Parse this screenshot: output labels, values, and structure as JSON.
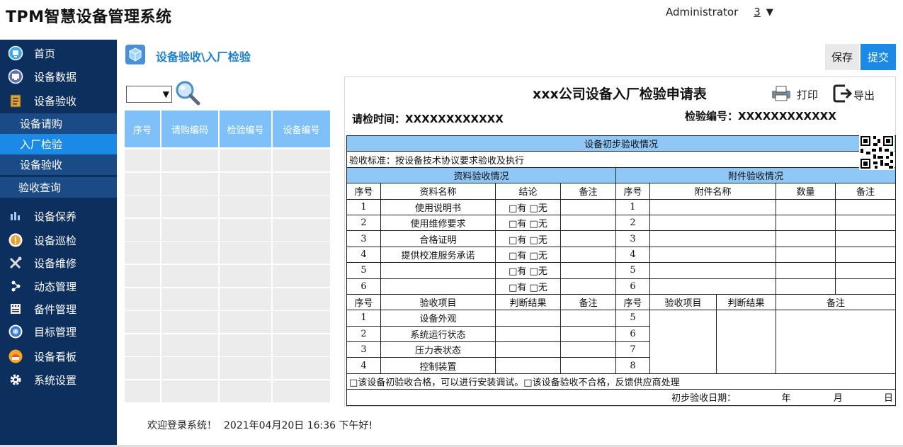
{
  "app": {
    "title": "TPM智慧设备管理系统",
    "user": "Administrator",
    "user_count": "3",
    "caret": "▼"
  },
  "sidebar": {
    "items": [
      {
        "label": "首页",
        "icon": "home-icon"
      },
      {
        "label": "设备数据",
        "icon": "monitor-icon"
      },
      {
        "label": "设备验收",
        "icon": "clipboard-icon"
      },
      {
        "label": "设备保养",
        "icon": "maintenance-icon"
      },
      {
        "label": "设备巡检",
        "icon": "patrol-icon"
      },
      {
        "label": "设备维修",
        "icon": "tools-icon"
      },
      {
        "label": "动态管理",
        "icon": "share-icon"
      },
      {
        "label": "备件管理",
        "icon": "parts-icon"
      },
      {
        "label": "目标管理",
        "icon": "target-icon"
      },
      {
        "label": "设备看板",
        "icon": "board-icon"
      },
      {
        "label": "系统设置",
        "icon": "gear-icon"
      }
    ],
    "sub_items": [
      {
        "label": "设备请购"
      },
      {
        "label": "入厂检验",
        "active": true
      },
      {
        "label": "设备验收"
      },
      {
        "label": "验收查询"
      }
    ]
  },
  "main": {
    "breadcrumb": "设备验收\\入厂检验",
    "save_label": "保存",
    "submit_label": "提交",
    "select_caret": "▼"
  },
  "list": {
    "headers": [
      "序号",
      "请购编码",
      "检验编号",
      "设备编号"
    ],
    "row_count": 11
  },
  "form": {
    "title": "xxx公司设备入厂检验申请表",
    "print_label": "打印",
    "export_label": "导出",
    "request_time": "请检时间：XXXXXXXXXXXX",
    "inspection_no": "检验编号：XXXXXXXXXXXX",
    "section_title": "设备初步验收情况",
    "standard": "验收标准：按设备技术协议要求验收及执行",
    "doc_section": "资料验收情况",
    "acc_section": "附件验收情况",
    "doc_headers": [
      "序号",
      "资料名称",
      "结论",
      "备注"
    ],
    "acc_headers": [
      "序号",
      "附件名称",
      "数量",
      "备注"
    ],
    "doc_rows": [
      {
        "no": "1",
        "name": "使用说明书",
        "result": "□有  □无"
      },
      {
        "no": "2",
        "name": "使用维修要求",
        "result": "□有  □无"
      },
      {
        "no": "3",
        "name": "合格证明",
        "result": "□有  □无"
      },
      {
        "no": "4",
        "name": "提供校准服务承诺",
        "result": "□有  □无"
      },
      {
        "no": "5",
        "name": "",
        "result": "□有  □无"
      },
      {
        "no": "6",
        "name": "",
        "result": "□有  □无"
      }
    ],
    "acc_nos": [
      "1",
      "2",
      "3",
      "4",
      "5",
      "6"
    ],
    "check_headers": [
      "序号",
      "验收项目",
      "判断结果",
      "备注"
    ],
    "check_headers_right": [
      "序号",
      "验收项目",
      "判断结果",
      "备注"
    ],
    "check_rows": [
      {
        "no": "1",
        "item": "设备外观"
      },
      {
        "no": "2",
        "item": "系统运行状态"
      },
      {
        "no": "3",
        "item": "压力表状态"
      },
      {
        "no": "4",
        "item": "控制装置"
      }
    ],
    "check_nos_right": [
      "5",
      "6",
      "7",
      "8"
    ],
    "conclusion": "□该设备初验收合格，可以进行安装调试。□该设备验收不合格，反馈供应商处理",
    "date_label": "初步验收日期：",
    "date_year": "年",
    "date_month": "月",
    "date_day": "日"
  },
  "footer": {
    "welcome": "欢迎登录系统！",
    "datetime": "2021年04月20日 16:36 下午好!"
  }
}
